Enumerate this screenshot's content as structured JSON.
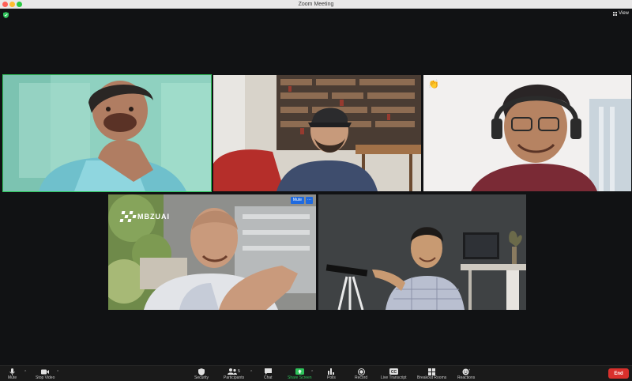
{
  "window": {
    "title": "Zoom Meeting"
  },
  "header": {
    "view_label": "View"
  },
  "tiles": {
    "tile4": {
      "logo_text": "MBZUAI",
      "mute_label": "Mute",
      "more_label": "···"
    },
    "tile3": {
      "reaction": "👏"
    }
  },
  "toolbar": {
    "mute_label": "Mute",
    "stop_video_label": "Stop Video",
    "security_label": "Security",
    "participants_label": "Participants",
    "participants_count": "5",
    "chat_label": "Chat",
    "share_label": "Share Screen",
    "polls_label": "Polls",
    "record_label": "Record",
    "transcript_label": "Live Transcript",
    "breakout_label": "Breakout Rooms",
    "reactions_label": "Reactions",
    "end_label": "End"
  },
  "colors": {
    "speaking_border": "#2ec35a",
    "end_button": "#d9302c",
    "share_green": "#2ec35a",
    "chip_blue": "#1e6ae0"
  }
}
